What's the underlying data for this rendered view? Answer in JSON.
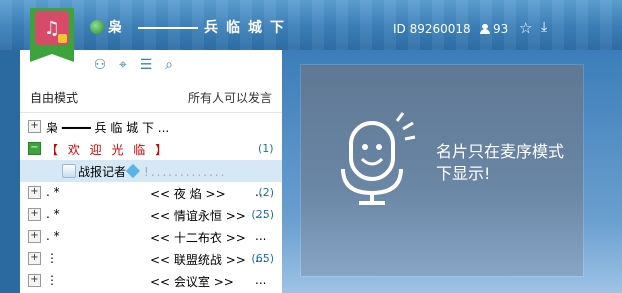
{
  "header": {
    "channel_name": "兵临城下",
    "channel_prefix": "枭",
    "channel_id": "ID 89260018",
    "online_count": "93",
    "icons": [
      "globe-icon",
      "star-icon",
      "download-icon",
      "user-icon"
    ]
  },
  "toolbar": {
    "icons": [
      "user-search-icon",
      "location-icon",
      "member-list-icon",
      "search-icon"
    ]
  },
  "mode_bar": {
    "mode_label": "自由模式",
    "permission_label": "所有人可以发言"
  },
  "tree": {
    "root": {
      "expander": "+",
      "text": "枭 ━━━━ 兵 临 城 下 ..."
    },
    "welcome": {
      "expander": "−",
      "text": "【 欢 迎 光 临 】",
      "count": "(1)"
    },
    "member": {
      "name": "战报记者",
      "suffix": "!.............",
      "selected": true
    },
    "channels": [
      {
        "expander": "+",
        "prefix": ". *",
        "name": "<< 夜   焰 >>",
        "dots": "...",
        "count": "(2)"
      },
      {
        "expander": "+",
        "prefix": ". *",
        "name": "<< 情谊永恒 >>",
        "dots": "...",
        "count": "(25)"
      },
      {
        "expander": "+",
        "prefix": ". *",
        "name": "<< 十二布衣 >>",
        "dots": "...",
        "count": ""
      },
      {
        "expander": "+",
        "prefix": "  ⋮",
        "name": "<< 联盟统战 >>",
        "dots": "...",
        "count": "(65)"
      },
      {
        "expander": "+",
        "prefix": "  ⋮",
        "name": "<< 会议室 >>",
        "dots": "...",
        "count": ""
      }
    ]
  },
  "card": {
    "message": "名片只在麦序模式下显示!"
  }
}
